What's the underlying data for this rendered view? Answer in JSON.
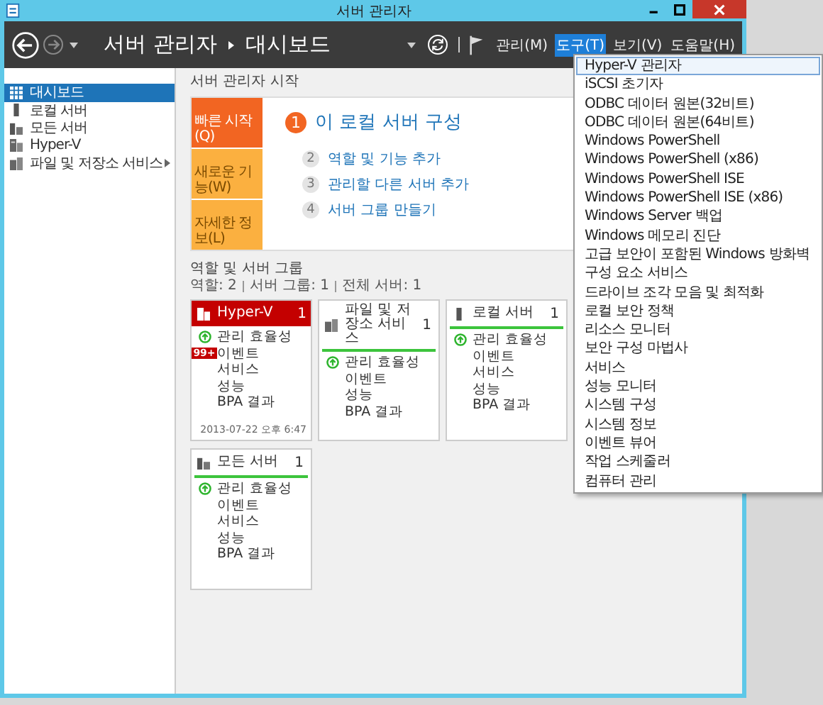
{
  "window": {
    "title": "서버 관리자"
  },
  "breadcrumb": [
    "서버 관리자",
    "대시보드"
  ],
  "menus": [
    {
      "label": "관리(M)",
      "selected": false
    },
    {
      "label": "도구(T)",
      "selected": true
    },
    {
      "label": "보기(V)",
      "selected": false
    },
    {
      "label": "도움말(H)",
      "selected": false
    }
  ],
  "dropdown": [
    {
      "label": "Hyper-V 관리자",
      "selected": true
    },
    {
      "label": "iSCSI 초기자",
      "selected": false
    },
    {
      "label": "ODBC 데이터 원본(32비트)",
      "selected": false
    },
    {
      "label": "ODBC 데이터 원본(64비트)",
      "selected": false
    },
    {
      "label": "Windows PowerShell",
      "selected": false
    },
    {
      "label": "Windows PowerShell (x86)",
      "selected": false
    },
    {
      "label": "Windows PowerShell ISE",
      "selected": false
    },
    {
      "label": "Windows PowerShell ISE (x86)",
      "selected": false
    },
    {
      "label": "Windows Server 백업",
      "selected": false
    },
    {
      "label": "Windows 메모리 진단",
      "selected": false
    },
    {
      "label": "고급 보안이 포함된 Windows 방화벽",
      "selected": false
    },
    {
      "label": "구성 요소 서비스",
      "selected": false
    },
    {
      "label": "드라이브 조각 모음 및 최적화",
      "selected": false
    },
    {
      "label": "로컬 보안 정책",
      "selected": false
    },
    {
      "label": "리소스 모니터",
      "selected": false
    },
    {
      "label": "보안 구성 마법사",
      "selected": false
    },
    {
      "label": "서비스",
      "selected": false
    },
    {
      "label": "성능 모니터",
      "selected": false
    },
    {
      "label": "시스템 구성",
      "selected": false
    },
    {
      "label": "시스템 정보",
      "selected": false
    },
    {
      "label": "이벤트 뷰어",
      "selected": false
    },
    {
      "label": "작업 스케줄러",
      "selected": false
    },
    {
      "label": "컴퓨터 관리",
      "selected": false
    }
  ],
  "sidebar": {
    "items": [
      {
        "label": "대시보드",
        "kind": "dashboard",
        "selected": true,
        "expandable": false
      },
      {
        "label": "로컬 서버",
        "kind": "server",
        "selected": false,
        "expandable": false
      },
      {
        "label": "모든 서버",
        "kind": "servers",
        "selected": false,
        "expandable": false
      },
      {
        "label": "Hyper-V",
        "kind": "role",
        "selected": false,
        "expandable": false
      },
      {
        "label": "파일 및 저장소 서비스",
        "kind": "storage",
        "selected": false,
        "expandable": true
      }
    ]
  },
  "welcome": {
    "heading": "서버 관리자 시작",
    "tiles": [
      {
        "label": "빠른 시작(Q)",
        "selected": true
      },
      {
        "label": "새로운 기능(W)",
        "selected": false
      },
      {
        "label": "자세한 정보(L)",
        "selected": false
      }
    ],
    "steps": [
      {
        "number": "1",
        "label": "이 로컬 서버 구성",
        "primary": true
      },
      {
        "number": "2",
        "label": "역할 및 기능 추가",
        "primary": false
      },
      {
        "number": "3",
        "label": "관리할 다른 서버 추가",
        "primary": false
      },
      {
        "number": "4",
        "label": "서버 그룹 만들기",
        "primary": false
      }
    ]
  },
  "groups": {
    "heading": "역할 및 서버 그룹",
    "counts": [
      "역할: 2",
      "서버 그룹: 1",
      "전체 서버: 1"
    ],
    "cards": [
      {
        "title": "Hyper-V",
        "kind": "role",
        "count": "1",
        "alert": true,
        "rows": [
          {
            "label": "관리 효율성",
            "kind": "status"
          },
          {
            "label": "이벤트",
            "kind": "plain",
            "badge": "99+"
          },
          {
            "label": "서비스",
            "kind": "plain"
          },
          {
            "label": "성능",
            "kind": "plain"
          },
          {
            "label": "BPA 결과",
            "kind": "plain"
          }
        ],
        "timestamp": "2013-07-22 오후 6:47"
      },
      {
        "title": "파일 및 저장소 서비스",
        "kind": "storage",
        "count": "1",
        "alert": false,
        "rows": [
          {
            "label": "관리 효율성",
            "kind": "status"
          },
          {
            "label": "이벤트",
            "kind": "plain"
          },
          {
            "label": "성능",
            "kind": "plain"
          },
          {
            "label": "BPA 결과",
            "kind": "plain"
          }
        ]
      },
      {
        "title": "로컬 서버",
        "kind": "server",
        "count": "1",
        "alert": false,
        "rows": [
          {
            "label": "관리 효율성",
            "kind": "status"
          },
          {
            "label": "이벤트",
            "kind": "plain"
          },
          {
            "label": "서비스",
            "kind": "plain"
          },
          {
            "label": "성능",
            "kind": "plain"
          },
          {
            "label": "BPA 결과",
            "kind": "plain"
          }
        ]
      },
      {
        "title": "모든 서버",
        "kind": "servers",
        "count": "1",
        "alert": false,
        "rows": [
          {
            "label": "관리 효율성",
            "kind": "status"
          },
          {
            "label": "이벤트",
            "kind": "plain"
          },
          {
            "label": "서비스",
            "kind": "plain"
          },
          {
            "label": "성능",
            "kind": "plain"
          },
          {
            "label": "BPA 결과",
            "kind": "plain"
          }
        ]
      }
    ]
  }
}
